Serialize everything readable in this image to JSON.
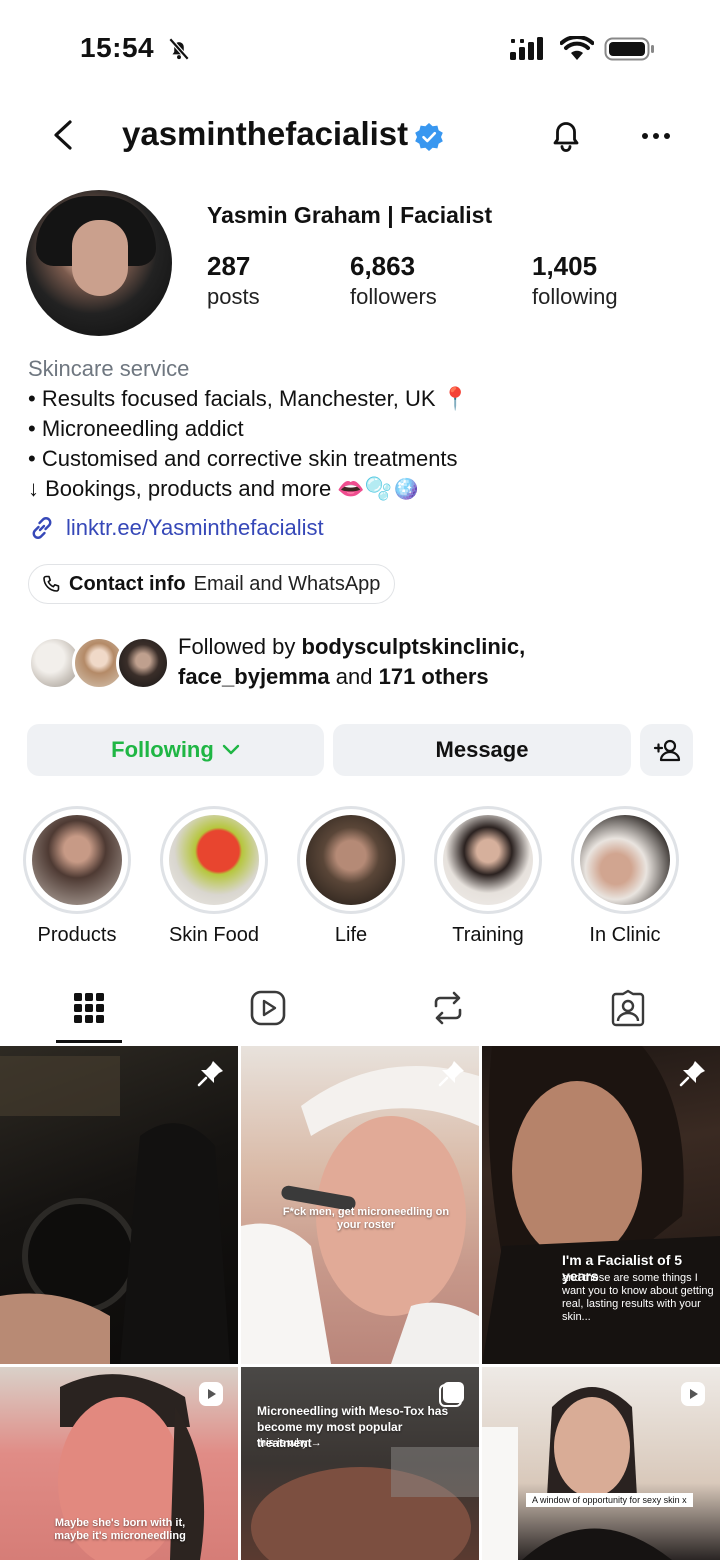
{
  "status_bar": {
    "time": "15:54"
  },
  "header": {
    "username": "yasminthefacialist"
  },
  "profile": {
    "display_name": "Yasmin Graham | Facialist",
    "stats": [
      {
        "value": "287",
        "label": "posts"
      },
      {
        "value": "6,863",
        "label": "followers"
      },
      {
        "value": "1,405",
        "label": "following"
      }
    ]
  },
  "bio": {
    "category": "Skincare service",
    "lines": [
      "• Results focused facials, Manchester, UK 📍",
      "• Microneedling addict",
      "• Customised and corrective skin treatments",
      "↓ Bookings, products and more 👄🫧🪩"
    ],
    "link": "linktr.ee/Yasminthefacialist"
  },
  "contact": {
    "label": "Contact info",
    "value": "Email and WhatsApp"
  },
  "followed_by": {
    "prefix": "Followed by ",
    "first": "bodysculptskinclinic,",
    "second": "face_byjemma",
    "middle": " and ",
    "others": "171 others"
  },
  "actions": {
    "following": "Following",
    "message": "Message"
  },
  "highlights": [
    {
      "label": "Products"
    },
    {
      "label": "Skin Food"
    },
    {
      "label": "Life"
    },
    {
      "label": "Training"
    },
    {
      "label": "In Clinic"
    }
  ],
  "posts": [
    {
      "caption": ""
    },
    {
      "caption": "F*ck men, get microneedling on your roster"
    },
    {
      "caption": "I'm a Facialist of 5 years",
      "sub": "and these are some things I want you to know about getting real, lasting results with your skin..."
    },
    {
      "caption": "Maybe she's born with it, maybe it's microneedling"
    },
    {
      "caption": "Microneedling with Meso-Tox has become my most popular treatment",
      "sub": "this is why →"
    },
    {
      "caption": "A window of opportunity for sexy skin x"
    }
  ],
  "colors": {
    "following_green": "#1fb644",
    "link_blue": "#3648b8",
    "verified_blue": "#3897f0",
    "button_bg": "#eff1f4"
  }
}
